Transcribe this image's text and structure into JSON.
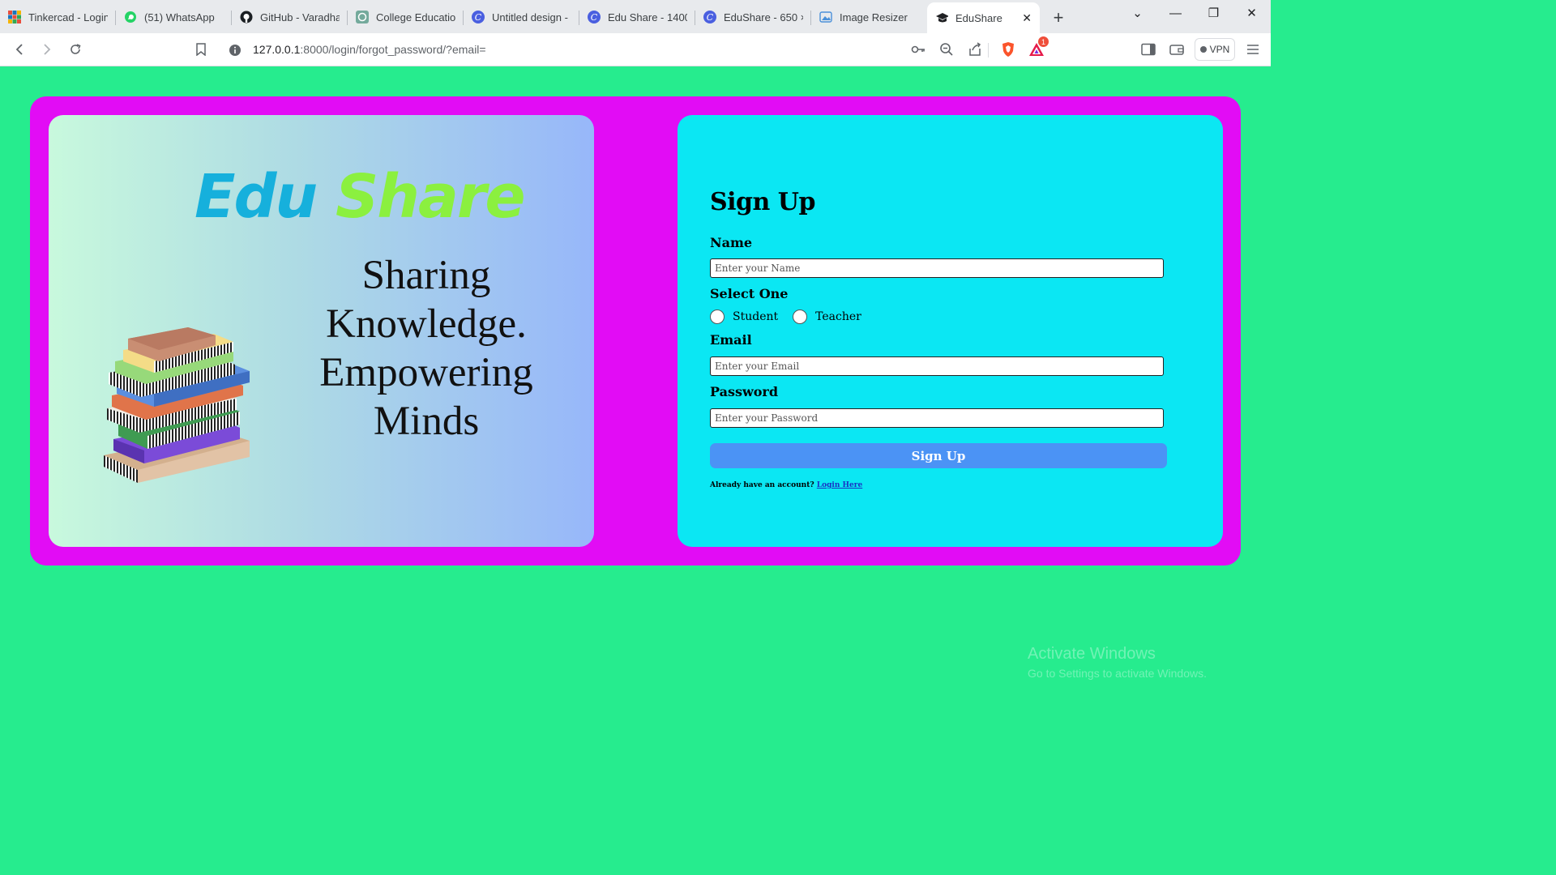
{
  "browser": {
    "tabs": [
      {
        "title": "Tinkercad - Login",
        "icon": "tinkercad-icon"
      },
      {
        "title": "(51) WhatsApp",
        "icon": "whatsapp-icon"
      },
      {
        "title": "GitHub - Varadha",
        "icon": "github-icon"
      },
      {
        "title": "College Education",
        "icon": "chatgpt-icon"
      },
      {
        "title": "Untitled design - ",
        "icon": "canva-icon"
      },
      {
        "title": "Edu Share - 1400",
        "icon": "canva-icon"
      },
      {
        "title": "EduShare - 650 ×",
        "icon": "canva-icon"
      },
      {
        "title": "Image Resizer",
        "icon": "image-icon"
      },
      {
        "title": "EduShare",
        "icon": "graduation-cap-icon",
        "active": true
      }
    ],
    "url_host": "127.0.0.1",
    "url_rest": ":8000/login/forgot_password/?email=",
    "vpn_label": "VPN",
    "brave_badge": "1"
  },
  "hero": {
    "brand_word1": "Edu",
    "brand_word2": "Share",
    "tagline_line1": "Sharing",
    "tagline_line2": "Knowledge.",
    "tagline_line3": "Empowering",
    "tagline_line4": "Minds"
  },
  "form": {
    "title": "Sign Up",
    "name_label": "Name",
    "name_placeholder": "Enter your Name",
    "role_label": "Select One",
    "role_student": "Student",
    "role_teacher": "Teacher",
    "email_label": "Email",
    "email_placeholder": "Enter your Email",
    "password_label": "Password",
    "password_placeholder": "Enter your Password",
    "submit_label": "Sign Up",
    "already_text": "Already have an account?",
    "login_link": "Login Here"
  },
  "watermark": {
    "line1": "Activate Windows",
    "line2": "Go to Settings to activate Windows."
  },
  "colors": {
    "page_bg": "#26ec8e",
    "frame": "#e20cf5",
    "form_card": "#0be7f3",
    "button": "#4b93f5"
  }
}
